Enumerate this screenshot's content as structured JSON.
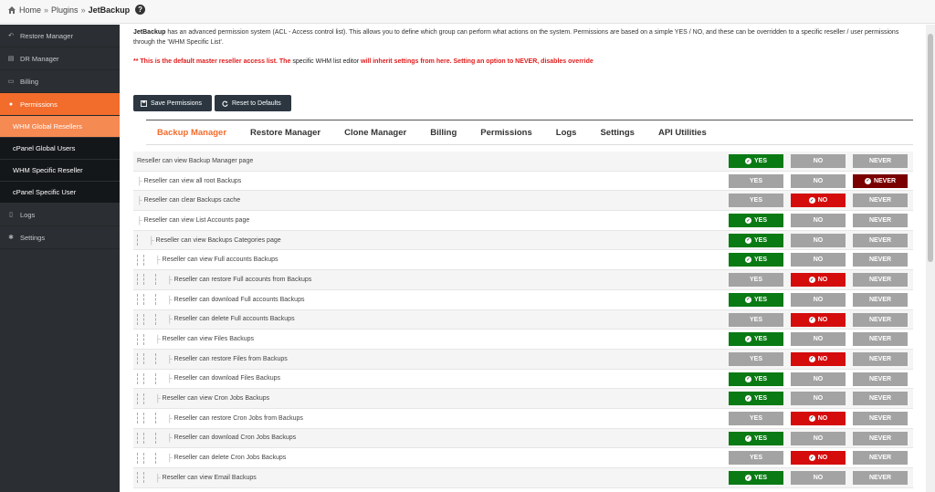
{
  "breadcrumb": {
    "home": "Home",
    "plugins": "Plugins",
    "current": "JetBackup",
    "help": "?"
  },
  "sidebar": {
    "items": [
      {
        "label": "Restore Manager",
        "icon": "undo-icon"
      },
      {
        "label": "DR Manager",
        "icon": "folder-icon"
      },
      {
        "label": "Billing",
        "icon": "billing-icon"
      },
      {
        "label": "Permissions",
        "icon": "users-icon",
        "active": true
      },
      {
        "label": "Logs",
        "icon": "file-icon"
      },
      {
        "label": "Settings",
        "icon": "gears-icon"
      }
    ],
    "subitems": [
      "WHM Global Resellers",
      "cPanel Global Users",
      "WHM Specific Reseller",
      "cPanel Specific User"
    ]
  },
  "intro": {
    "bold": "JetBackup",
    "text1": " has an advanced permission system (ACL - Access control list). This allows you to define which group can perform what actions on the system. Permissions are based on a simple YES / NO, and these can be overridden to a specific reseller / user permissions through the 'WHM Specific List'."
  },
  "warning": {
    "part1": "** This is the default master reseller access list. The ",
    "part2": "specific WHM list editor",
    "part3": " will inherit settings from here. Setting an option to NEVER, disables override"
  },
  "buttons": {
    "save": "Save Permissions",
    "reset": "Reset to Defaults"
  },
  "tabs": [
    "Backup Manager",
    "Restore Manager",
    "Clone Manager",
    "Billing",
    "Permissions",
    "Logs",
    "Settings",
    "API Utilities"
  ],
  "options": {
    "yes": "YES",
    "no": "NO",
    "never": "NEVER"
  },
  "rows": [
    {
      "label": "Reseller can view Backup Manager page",
      "level": 0,
      "state": "yes"
    },
    {
      "label": "Reseller can view all root Backups",
      "level": 1,
      "state": "never"
    },
    {
      "label": "Reseller can clear Backups cache",
      "level": 1,
      "state": "no"
    },
    {
      "label": "Reseller can view List Accounts page",
      "level": 1,
      "state": "yes"
    },
    {
      "label": "Reseller can view Backups Categories page",
      "level": 2,
      "state": "yes"
    },
    {
      "label": "Reseller can view Full accounts Backups",
      "level": 3,
      "state": "yes"
    },
    {
      "label": "Reseller can restore Full accounts from Backups",
      "level": 4,
      "state": "no"
    },
    {
      "label": "Reseller can download Full accounts Backups",
      "level": 4,
      "state": "yes"
    },
    {
      "label": "Reseller can delete Full accounts Backups",
      "level": 4,
      "state": "no"
    },
    {
      "label": "Reseller can view Files Backups",
      "level": 3,
      "state": "yes"
    },
    {
      "label": "Reseller can restore Files from Backups",
      "level": 4,
      "state": "no"
    },
    {
      "label": "Reseller can download Files Backups",
      "level": 4,
      "state": "yes"
    },
    {
      "label": "Reseller can view Cron Jobs Backups",
      "level": 3,
      "state": "yes"
    },
    {
      "label": "Reseller can restore Cron Jobs from Backups",
      "level": 4,
      "state": "no"
    },
    {
      "label": "Reseller can download Cron Jobs Backups",
      "level": 4,
      "state": "yes"
    },
    {
      "label": "Reseller can delete Cron Jobs Backups",
      "level": 4,
      "state": "no"
    },
    {
      "label": "Reseller can view Email Backups",
      "level": 3,
      "state": "yes"
    }
  ]
}
